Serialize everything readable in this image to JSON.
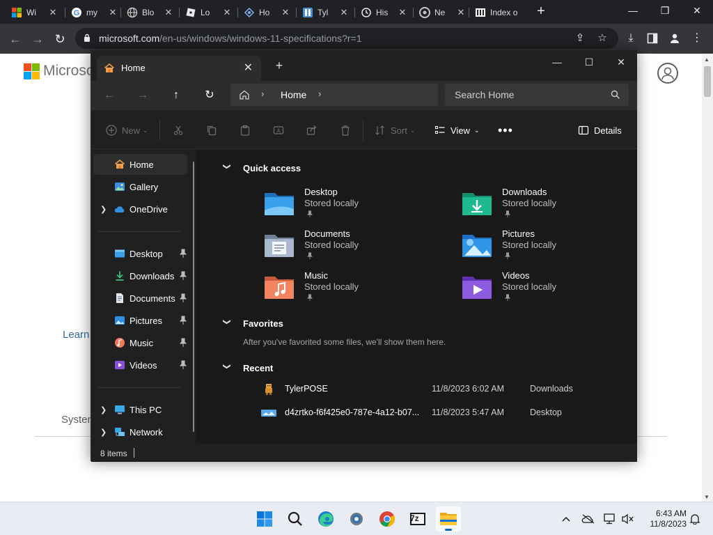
{
  "browser": {
    "tabs": [
      {
        "title": "Wi",
        "icon": "windows-icon"
      },
      {
        "title": "my",
        "icon": "google-icon"
      },
      {
        "title": "Blo",
        "icon": "globe-icon"
      },
      {
        "title": "Lo",
        "icon": "roblox-icon"
      },
      {
        "title": "Ho",
        "icon": "hotspot-icon"
      },
      {
        "title": "Tyl",
        "icon": "tyler-icon"
      },
      {
        "title": "His",
        "icon": "history-icon"
      },
      {
        "title": "Ne",
        "icon": "chrome-icon"
      },
      {
        "title": "Index o",
        "icon": "archive-icon"
      }
    ],
    "url_domain": "microsoft.com",
    "url_rest": "/en-us/windows/windows-11-specifications?r=1"
  },
  "webpage": {
    "brand": "Microso",
    "learn_text": "Learn",
    "system_text": "System"
  },
  "explorer": {
    "tab_title": "Home",
    "breadcrumb": "Home",
    "search_placeholder": "Search Home",
    "commands": {
      "new": "New",
      "sort": "Sort",
      "view": "View",
      "details": "Details"
    },
    "nav": {
      "top": [
        {
          "label": "Home",
          "icon": "home-icon"
        },
        {
          "label": "Gallery",
          "icon": "gallery-icon"
        },
        {
          "label": "OneDrive",
          "icon": "onedrive-icon"
        }
      ],
      "pinned": [
        {
          "label": "Desktop",
          "icon": "desktop-folder-icon"
        },
        {
          "label": "Downloads",
          "icon": "downloads-icon"
        },
        {
          "label": "Documents",
          "icon": "documents-icon"
        },
        {
          "label": "Pictures",
          "icon": "pictures-icon"
        },
        {
          "label": "Music",
          "icon": "music-icon"
        },
        {
          "label": "Videos",
          "icon": "videos-icon"
        }
      ],
      "bottom": [
        {
          "label": "This PC",
          "icon": "this-pc-icon"
        },
        {
          "label": "Network",
          "icon": "network-icon"
        }
      ]
    },
    "sections": {
      "quick_access": "Quick access",
      "favorites": "Favorites",
      "recent": "Recent"
    },
    "quick_access": [
      {
        "name": "Desktop",
        "status": "Stored locally"
      },
      {
        "name": "Downloads",
        "status": "Stored locally"
      },
      {
        "name": "Documents",
        "status": "Stored locally"
      },
      {
        "name": "Pictures",
        "status": "Stored locally"
      },
      {
        "name": "Music",
        "status": "Stored locally"
      },
      {
        "name": "Videos",
        "status": "Stored locally"
      }
    ],
    "favorites_hint": "After you've favorited some files, we'll show them here.",
    "recent": [
      {
        "name": "TylerPOSE",
        "date": "11/8/2023 6:02 AM",
        "location": "Downloads"
      },
      {
        "name": "d4zrtko-f6f425e0-787e-4a12-b07...",
        "date": "11/8/2023 5:47 AM",
        "location": "Desktop"
      }
    ],
    "status": "8 items"
  },
  "taskbar": {
    "time": "6:43 AM",
    "date": "11/8/2023",
    "apps": [
      "start-icon",
      "search-icon",
      "edge-icon",
      "settings-icon",
      "chrome-icon",
      "7zip-icon",
      "file-explorer-icon"
    ],
    "seven_zip_label": "7z"
  },
  "colors": {
    "explorer_bg": "#191919",
    "accent": "#0067c0",
    "browser_bg": "#202124"
  }
}
